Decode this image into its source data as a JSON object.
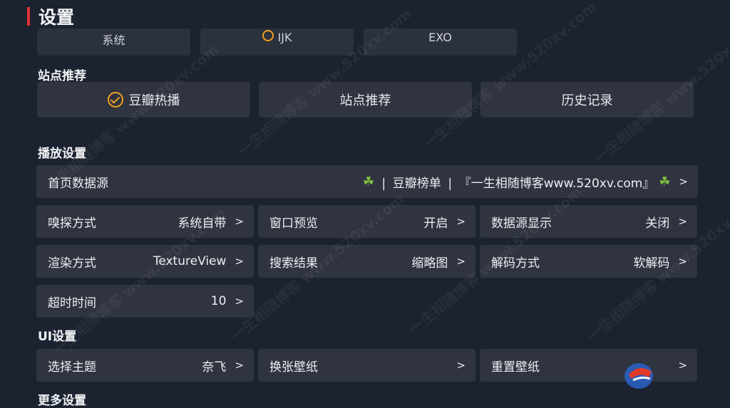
{
  "header": {
    "title": "设置"
  },
  "top_row": [
    {
      "label": "系统",
      "checked": false
    },
    {
      "label": "IJK",
      "checked": true
    },
    {
      "label": "EXO",
      "checked": false
    }
  ],
  "site_section": {
    "label": "站点推荐",
    "buttons": [
      {
        "label": "豆瓣热播",
        "selected": true
      },
      {
        "label": "站点推荐",
        "selected": false
      },
      {
        "label": "历史记录",
        "selected": false
      }
    ]
  },
  "play_section": {
    "label": "播放设置",
    "home_source": {
      "label": "首页数据源",
      "value": "❘ 豆瓣榜单 ❘ 『一生相随博客www.520xv.com』",
      "chevron": ">"
    },
    "rows": [
      [
        {
          "label": "嗅探方式",
          "value": "系统自带",
          "chevron": ">"
        },
        {
          "label": "窗口预览",
          "value": "开启",
          "chevron": ">"
        },
        {
          "label": "数据源显示",
          "value": "关闭",
          "chevron": ">"
        }
      ],
      [
        {
          "label": "渲染方式",
          "value": "TextureView",
          "chevron": ">"
        },
        {
          "label": "搜索结果",
          "value": "缩略图",
          "chevron": ">"
        },
        {
          "label": "解码方式",
          "value": "软解码",
          "chevron": ">"
        }
      ],
      [
        {
          "label": "超时时间",
          "value": "10",
          "chevron": ">"
        }
      ]
    ]
  },
  "ui_section": {
    "label": "UI设置",
    "rows": [
      [
        {
          "label": "选择主题",
          "value": "奈飞",
          "chevron": ">"
        },
        {
          "label": "换张壁纸",
          "value": "",
          "chevron": ">"
        },
        {
          "label": "重置壁纸",
          "value": "",
          "chevron": ">"
        }
      ]
    ]
  },
  "more_section": {
    "label": "更多设置"
  },
  "watermark": {
    "text": "一生相随博客 www.520xv.com"
  },
  "colors": {
    "accent": "#e0322f",
    "check": "#f0a020",
    "bg": "#1b2230",
    "card": "#2f3440"
  }
}
